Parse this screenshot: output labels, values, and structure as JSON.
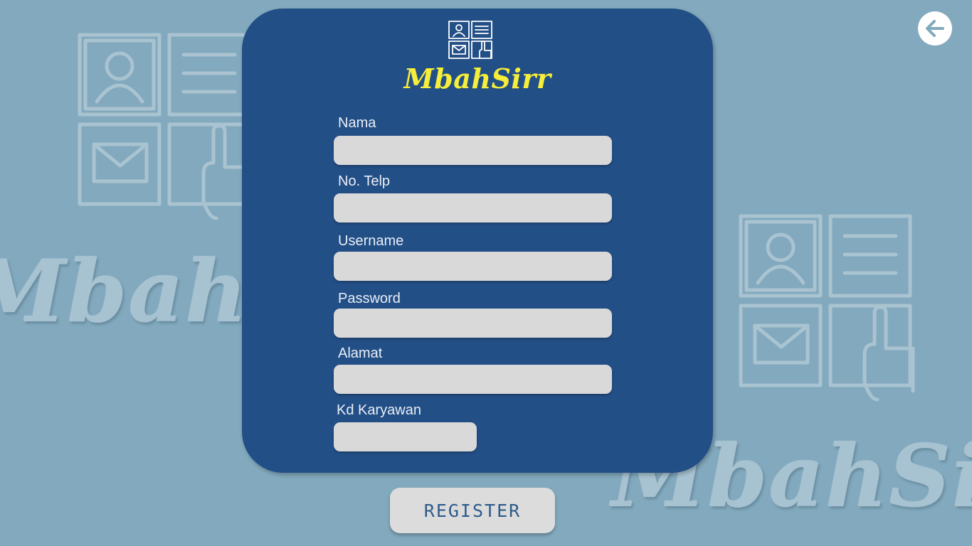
{
  "app": {
    "brand_name": "MbahSirr"
  },
  "background": {
    "watermark_text": "MbahSirr",
    "color": "#82a9bd"
  },
  "nav": {
    "back_icon": "arrow-left-icon"
  },
  "form": {
    "card_color": "#234f87",
    "logo_icon": "form-grid-icon",
    "fields": [
      {
        "key": "nama",
        "label": "Nama",
        "value": ""
      },
      {
        "key": "no_telp",
        "label": "No. Telp",
        "value": ""
      },
      {
        "key": "username",
        "label": "Username",
        "value": ""
      },
      {
        "key": "password",
        "label": "Password",
        "value": ""
      },
      {
        "key": "alamat",
        "label": "Alamat",
        "value": ""
      },
      {
        "key": "kd_karyawan",
        "label": "Kd Karyawan",
        "value": ""
      }
    ],
    "submit_label": "REGISTER"
  },
  "colors": {
    "accent_yellow": "#f5ee3a",
    "input_bg": "#d9d9d9",
    "button_text": "#2e5b8a"
  }
}
